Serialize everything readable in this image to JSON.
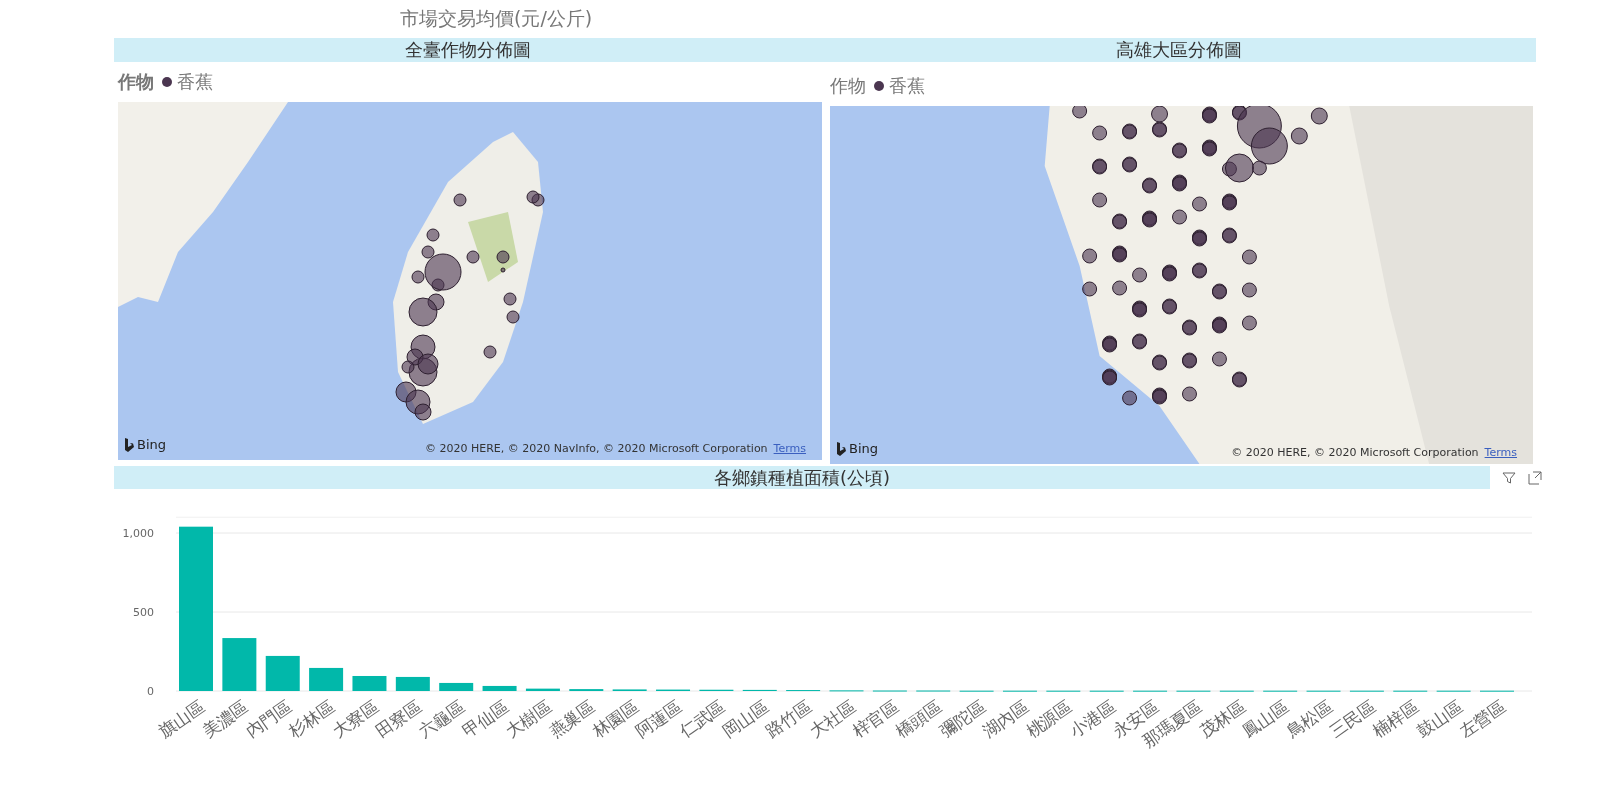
{
  "top_title": "市場交易均價(元/公斤)",
  "maps": [
    {
      "header": "全臺作物分佈圖",
      "legend": {
        "title": "作物",
        "item": "香蕉"
      },
      "logo_text": "Bing",
      "attribution": "© 2020 HERE, © 2020 NavInfo, © 2020 Microsoft Corporation",
      "terms": "Terms"
    },
    {
      "header": "高雄大區分佈圖",
      "legend": {
        "title": "作物",
        "item": "香蕉"
      },
      "logo_text": "Bing",
      "attribution": "© 2020 HERE, © 2020 Microsoft Corporation",
      "terms": "Terms"
    }
  ],
  "bar_visual": {
    "header": "各鄉鎮種植面積(公頃)",
    "chart_data": {
      "type": "bar",
      "categories": [
        "旗山區",
        "美濃區",
        "內門區",
        "杉林區",
        "大寮區",
        "田寮區",
        "六龜區",
        "甲仙區",
        "大樹區",
        "燕巢區",
        "林園區",
        "阿蓮區",
        "仁武區",
        "岡山區",
        "路竹區",
        "大社區",
        "梓官區",
        "橋頭區",
        "彌陀區",
        "湖內區",
        "桃源區",
        "小港區",
        "永安區",
        "那瑪夏區",
        "茂林區",
        "鳳山區",
        "鳥松區",
        "三民區",
        "楠梓區",
        "鼓山區",
        "左營區"
      ],
      "values": [
        1040,
        335,
        222,
        146,
        95,
        89,
        51,
        32,
        15,
        12,
        10,
        9,
        8,
        7,
        6,
        4,
        3,
        3,
        2,
        2,
        2,
        2,
        2,
        2,
        2,
        2,
        2,
        2,
        2,
        2,
        2
      ],
      "ylim": [
        0,
        1100
      ],
      "yticks": [
        {
          "value": 0,
          "label": "0"
        },
        {
          "value": 500,
          "label": "500"
        },
        {
          "value": 1000,
          "label": "1,000"
        }
      ]
    }
  }
}
